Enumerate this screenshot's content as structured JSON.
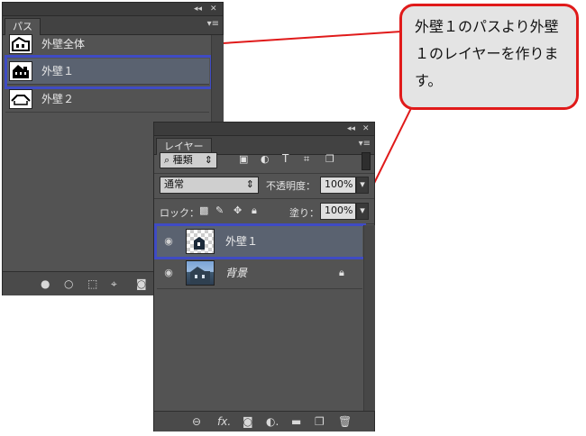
{
  "paths_panel": {
    "collapse_glyph": "◂◂",
    "close_glyph": "✕",
    "tab": "パス",
    "menu_glyph": "▾≡",
    "items": [
      {
        "label": "外壁全体"
      },
      {
        "label": "外壁１"
      },
      {
        "label": "外壁２"
      }
    ],
    "footer_icons": [
      "fill-path-icon",
      "stroke-path-icon",
      "load-as-selection-icon",
      "make-work-path-icon",
      "add-mask-icon"
    ]
  },
  "layers_panel": {
    "collapse_glyph": "◂◂",
    "close_glyph": "✕",
    "tab": "レイヤー",
    "menu_glyph": "▾≡",
    "filter": {
      "label": "種類",
      "search_glyph": "⌕"
    },
    "blend_mode": "通常",
    "opacity_label": "不透明度：",
    "opacity_value": "100%",
    "lock_label": "ロック：",
    "fill_label": "塗り：",
    "fill_value": "100%",
    "layers": [
      {
        "name": "外壁１",
        "selected": true
      },
      {
        "name": "背景",
        "locked": true
      }
    ],
    "footer_glyphs": {
      "link": "⊖",
      "fx": "fx.",
      "mask": "◙",
      "adjust": "◐.",
      "group": "▬",
      "new": "❐",
      "trash": "🗑"
    }
  },
  "callout": {
    "text": "外壁１のパスより外壁１のレイヤーを作ります。"
  }
}
